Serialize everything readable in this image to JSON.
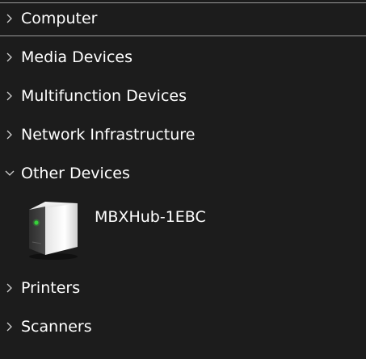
{
  "tree": {
    "categories": [
      {
        "label": "Computer",
        "expanded": false
      },
      {
        "label": "Media Devices",
        "expanded": false
      },
      {
        "label": "Multifunction Devices",
        "expanded": false
      },
      {
        "label": "Network Infrastructure",
        "expanded": false
      },
      {
        "label": "Other Devices",
        "expanded": true
      },
      {
        "label": "Printers",
        "expanded": false
      },
      {
        "label": "Scanners",
        "expanded": false
      }
    ],
    "other_devices": [
      {
        "label": "MBXHub-1EBC",
        "icon": "generic-device-icon"
      }
    ]
  },
  "colors": {
    "background": "#1c1c1c",
    "text": "#ffffff",
    "separator": "#9a9a9a",
    "chevron": "#d0d0d0",
    "device_led": "#36d23a"
  }
}
